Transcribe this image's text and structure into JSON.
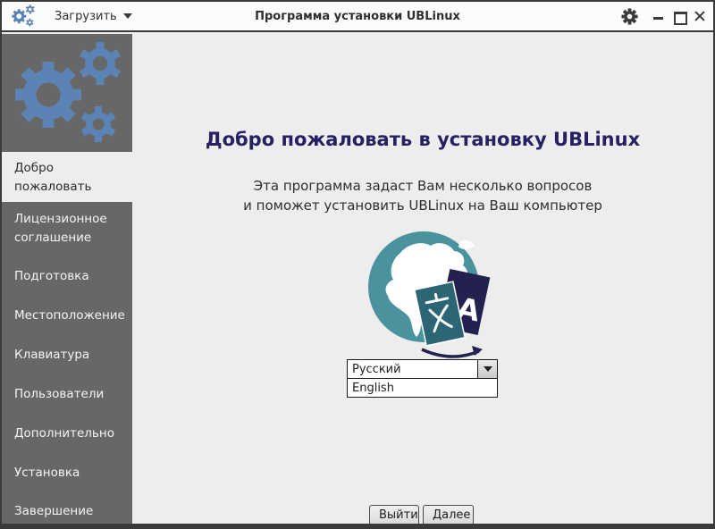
{
  "window": {
    "title": "Программа установки UBLinux",
    "menu": {
      "load_label": "Загрузить"
    }
  },
  "sidebar": {
    "items": [
      {
        "label": "Добро\nпожаловать",
        "active": true
      },
      {
        "label": "Лицензионное\nсоглашение",
        "active": false
      },
      {
        "label": "Подготовка",
        "active": false
      },
      {
        "label": "Местоположение",
        "active": false
      },
      {
        "label": "Клавиатура",
        "active": false
      },
      {
        "label": "Пользователи",
        "active": false
      },
      {
        "label": "Дополнительно",
        "active": false
      },
      {
        "label": "Установка",
        "active": false
      },
      {
        "label": "Завершение",
        "active": false
      }
    ]
  },
  "main": {
    "heading": "Добро пожаловать в установку UBLinux",
    "subtitle_line1": "Эта программа задаст Вам несколько вопросов",
    "subtitle_line2": "и поможет установить UBLinux на Ваш компьютер",
    "language": {
      "selected": "Русский",
      "dropdown_option": "English"
    },
    "buttons": {
      "exit": "Выйти",
      "next": "Далее"
    }
  },
  "icons": [
    "gears-logo-icon",
    "chevron-down-icon",
    "gear-settings-icon",
    "minimize-icon",
    "maximize-icon",
    "close-icon",
    "globe-translate-icon",
    "dropdown-arrow-icon"
  ],
  "colors": {
    "accent_blue": "#5b83b4",
    "heading_navy": "#272063",
    "globe_teal": "#4a929e",
    "book_teal": "#2c6573",
    "book_navy": "#22214f",
    "sidebar_gray": "#676767",
    "content_bg": "#ededed",
    "titlebar_bg": "#fcfcfc",
    "frame": "#3a3a3a"
  }
}
